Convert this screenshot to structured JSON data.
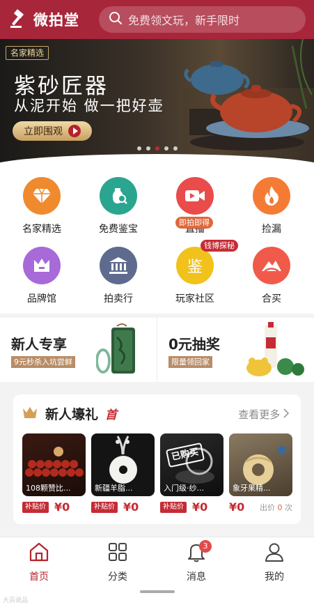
{
  "header": {
    "app_name": "微拍堂",
    "search_placeholder": "免费领文玩，新手限时"
  },
  "banner": {
    "tag": "名家精选",
    "title": "紫砂匠器",
    "subtitle": "从泥开始 做一把好壶",
    "button_label": "立即围观",
    "slide_count": 5,
    "active_slide": 3
  },
  "categories": [
    {
      "label": "名家精选",
      "icon": "diamond-icon",
      "color": "#f08a2e"
    },
    {
      "label": "免费鉴宝",
      "icon": "vase-search-icon",
      "color": "#2aa58f"
    },
    {
      "label": "直播",
      "icon": "video-icon",
      "color": "#ea4b4b",
      "tag": "即拍即得"
    },
    {
      "label": "捡漏",
      "icon": "flame-icon",
      "color": "#f57b35"
    },
    {
      "label": "品牌馆",
      "icon": "crown-icon",
      "color": "#a76ad8"
    },
    {
      "label": "拍卖行",
      "icon": "bank-icon",
      "color": "#5e6b8f"
    },
    {
      "label": "玩家社区",
      "icon": "jian-icon",
      "color": "#f1c21b",
      "tag": "钱博探秘"
    },
    {
      "label": "合买",
      "icon": "mountain-icon",
      "color": "#f05a4a"
    }
  ],
  "promos": [
    {
      "title": "新人专享",
      "subtitle": "9元秒杀入坑尝鲜"
    },
    {
      "title": "0元抽奖",
      "subtitle": "限量领回家"
    }
  ],
  "gift": {
    "title": "新人壕礼",
    "badge": "首",
    "see_more": "查看更多",
    "products": [
      {
        "caption": "108颗赞比...",
        "price_tag": "补贴价",
        "price": "¥0"
      },
      {
        "caption": "新疆羊脂...",
        "price_tag": "补贴价",
        "price": "¥0"
      },
      {
        "caption": "入门级·纱...",
        "price_tag": "补贴价",
        "price": "¥0",
        "stamp": "已购买"
      },
      {
        "caption": "象牙果精...",
        "price": "¥0",
        "bid_label": "出价",
        "bid_count": "0",
        "bid_unit": "次"
      }
    ]
  },
  "tabbar": {
    "items": [
      {
        "label": "首页",
        "icon": "home-icon",
        "active": true
      },
      {
        "label": "分类",
        "icon": "grid-icon"
      },
      {
        "label": "消息",
        "icon": "bell-icon",
        "badge": "3"
      },
      {
        "label": "我的",
        "icon": "user-icon"
      }
    ]
  },
  "watermark": "大百说品"
}
